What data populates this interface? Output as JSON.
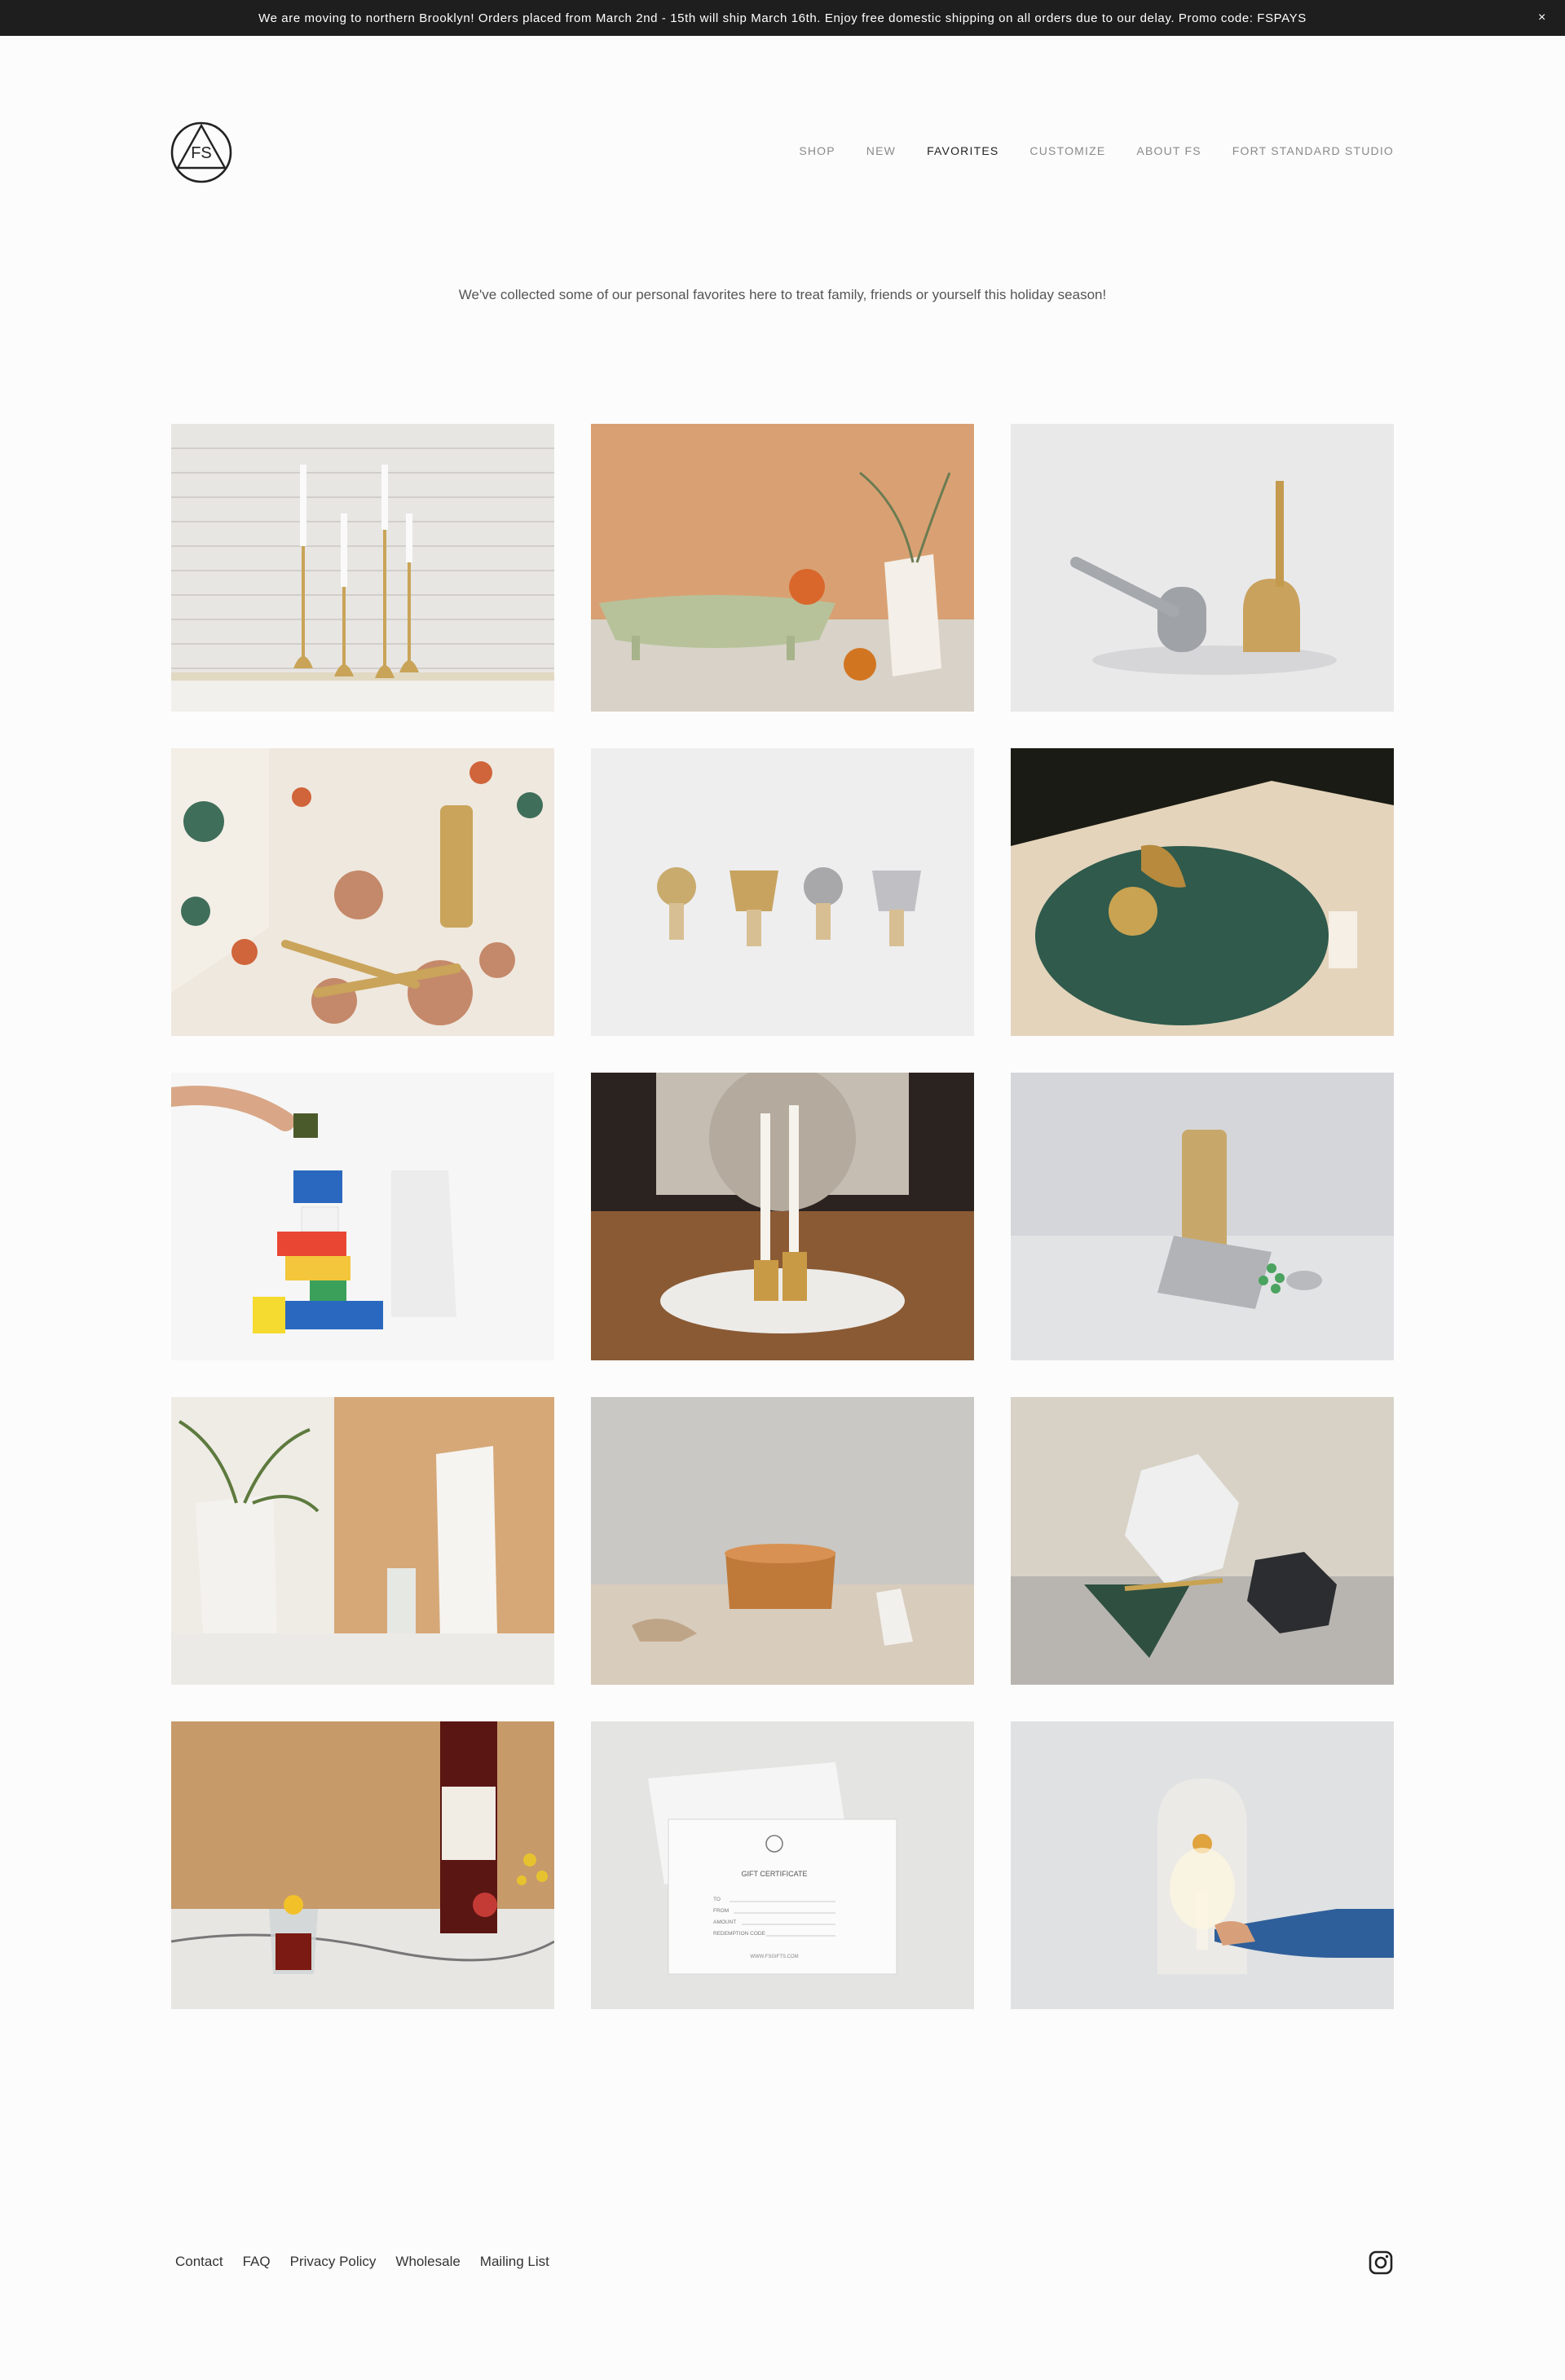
{
  "announcement": {
    "text": "We are moving to northern Brooklyn!  Orders placed from March 2nd - 15th will ship March 16th.  Enjoy free domestic shipping on all orders due to our delay.  Promo code: FSPAYS",
    "close": "×"
  },
  "logo": {
    "text": "FS",
    "icon": "fs-circle-triangle-logo"
  },
  "nav": {
    "items": [
      "SHOP",
      "NEW",
      "FAVORITES",
      "CUSTOMIZE",
      "ABOUT FS",
      "FORT STANDARD STUDIO"
    ],
    "active": "FAVORITES"
  },
  "intro": "We've collected some of our personal favorites here to treat family, friends or yourself this holiday season!",
  "products": [
    "brass-candlesticks-on-white-brick",
    "green-ceramic-tray-with-vase",
    "aluminum-and-brass-tools",
    "terrazzo-scene-with-brass-tools",
    "metal-bottle-stoppers",
    "green-marble-tray-with-brass-candle",
    "colorful-balancing-blocks",
    "brass-candle-holder-on-table",
    "match-cylinders",
    "white-faceted-vases",
    "copper-bowl",
    "marble-hexagon-coasters",
    "amaro-bottle-and-glass",
    "gift-certificate",
    "marble-wall-candle-sconce"
  ],
  "gift_certificate": {
    "title": "GIFT CERTIFICATE",
    "fields": [
      "TO",
      "FROM",
      "AMOUNT",
      "REDEMPTION CODE"
    ],
    "url": "WWW.FSGIFTS.COM"
  },
  "footer": {
    "links": [
      "Contact",
      "FAQ",
      "Privacy Policy",
      "Wholesale",
      "Mailing List"
    ],
    "social_icon": "instagram-icon"
  },
  "colors": {
    "bar": "#1e1e1e",
    "background": "#fcfcfc",
    "nav_inactive": "#8a8a8a",
    "nav_active": "#222222"
  }
}
